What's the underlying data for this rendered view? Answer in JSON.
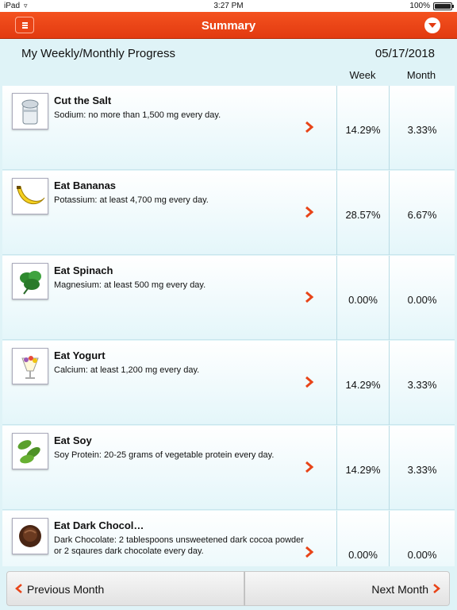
{
  "status_bar": {
    "carrier": "iPad",
    "time": "3:27 PM",
    "battery": "100%"
  },
  "nav": {
    "title": "Summary",
    "menu_icon": "hamburger-icon",
    "dropdown_icon": "chevron-down-circle-icon"
  },
  "header": {
    "heading": "My Weekly/Monthly Progress",
    "date": "05/17/2018",
    "col_week": "Week",
    "col_month": "Month"
  },
  "rows": [
    {
      "title": "Cut the Salt",
      "desc": "Sodium: no more than 1,500 mg every day.",
      "week": "14.29%",
      "month": "3.33%",
      "icon": "salt-shaker-icon"
    },
    {
      "title": "Eat Bananas",
      "desc": "Potassium: at least 4,700 mg every day.",
      "week": "28.57%",
      "month": "6.67%",
      "icon": "banana-icon"
    },
    {
      "title": "Eat Spinach",
      "desc": "Magnesium: at least 500 mg every day.",
      "week": "0.00%",
      "month": "0.00%",
      "icon": "spinach-icon"
    },
    {
      "title": "Eat Yogurt",
      "desc": "Calcium: at least 1,200 mg every day.",
      "week": "14.29%",
      "month": "3.33%",
      "icon": "yogurt-parfait-icon"
    },
    {
      "title": "Eat Soy",
      "desc": "Soy Protein: 20-25 grams of vegetable protein every day.",
      "week": "14.29%",
      "month": "3.33%",
      "icon": "soybean-icon"
    },
    {
      "title": "Eat Dark Chocol…",
      "desc": "Dark Chocolate: 2 tablespoons unsweetened dark cocoa powder or 2 sqaures dark chocolate every day.",
      "week": "0.00%",
      "month": "0.00%",
      "icon": "chocolate-icon"
    }
  ],
  "bottom": {
    "prev": "Previous Month",
    "next": "Next Month"
  },
  "colors": {
    "accent": "#e84418",
    "background": "#dff3f7"
  }
}
